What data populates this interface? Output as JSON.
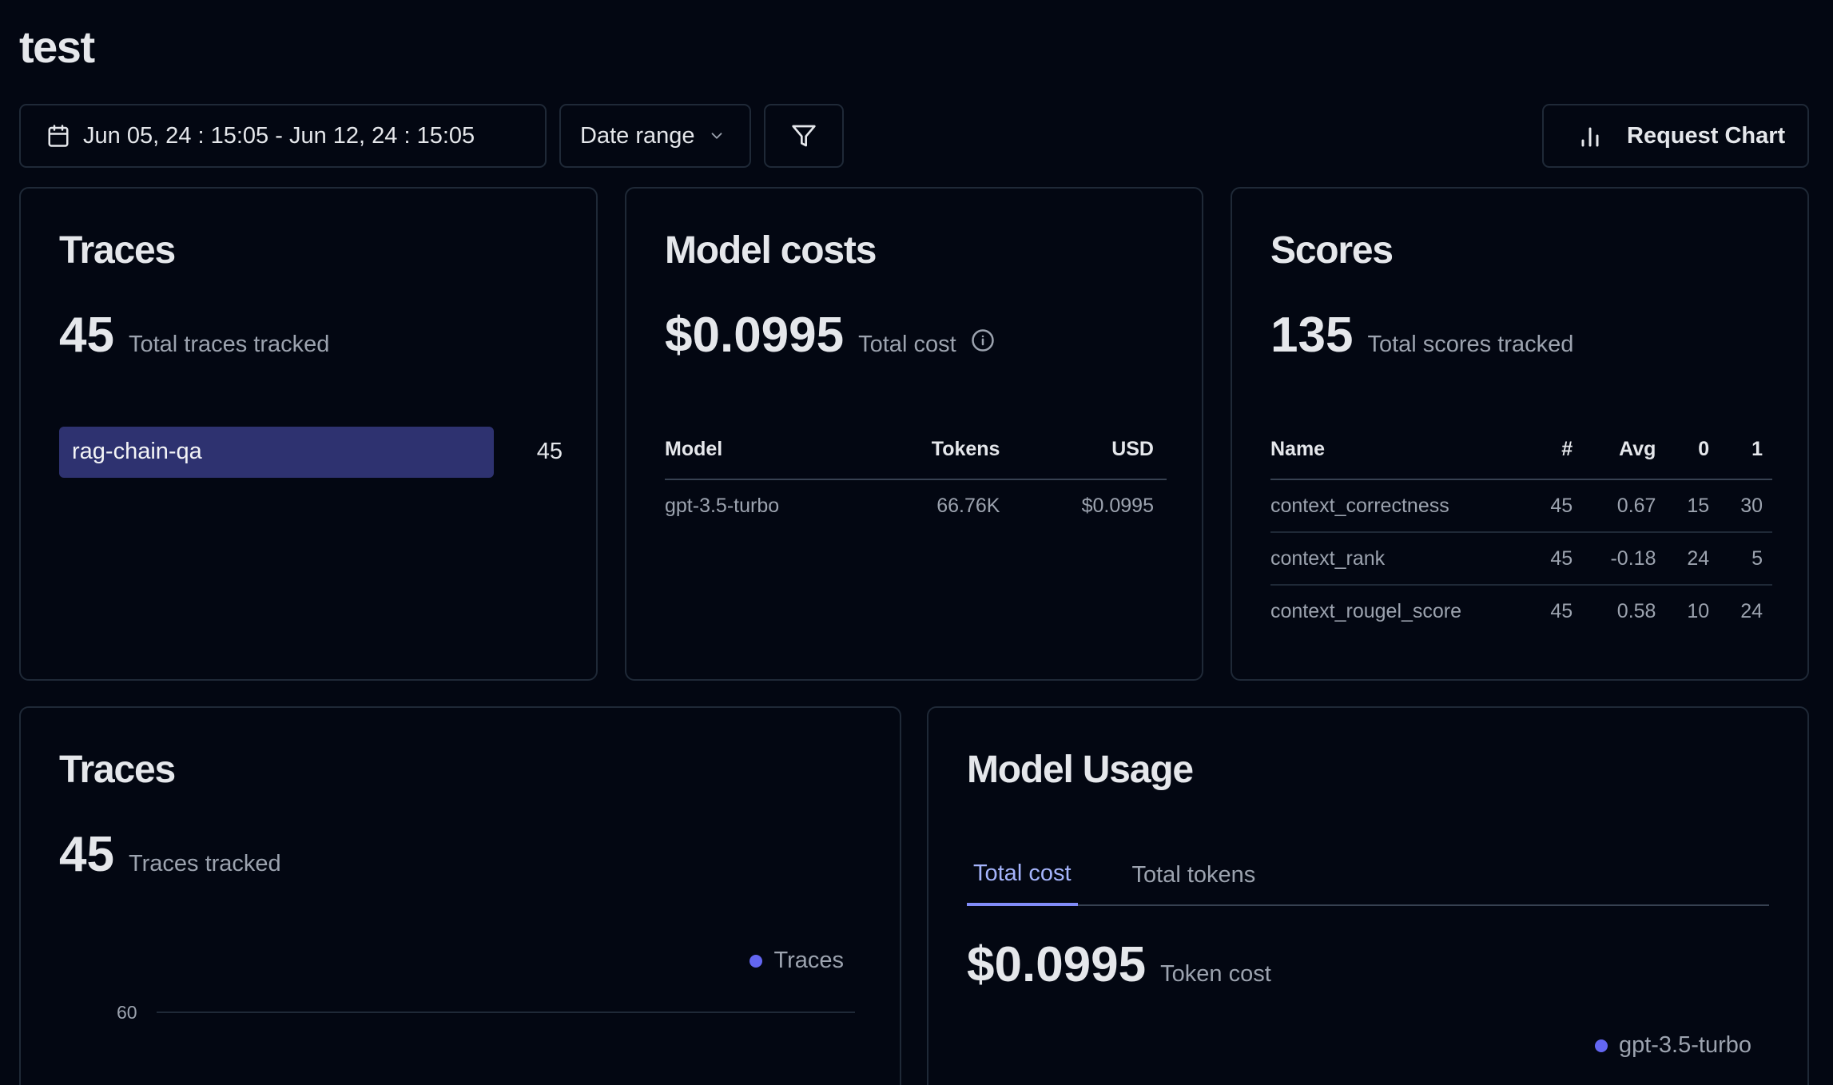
{
  "page": {
    "title": "test"
  },
  "toolbar": {
    "date_range_value": "Jun 05, 24 : 15:05 - Jun 12, 24 : 15:05",
    "date_range_select": "Date range",
    "request_chart_label": "Request Chart"
  },
  "traces_card": {
    "title": "Traces",
    "total": "45",
    "total_label": "Total traces tracked",
    "bars": [
      {
        "name": "rag-chain-qa",
        "value": "45",
        "fraction": 1.0
      }
    ]
  },
  "model_costs_card": {
    "title": "Model costs",
    "total": "$0.0995",
    "total_label": "Total cost",
    "columns": {
      "model": "Model",
      "tokens": "Tokens",
      "usd": "USD"
    },
    "rows": [
      {
        "model": "gpt-3.5-turbo",
        "tokens": "66.76K",
        "usd": "$0.0995"
      }
    ]
  },
  "scores_card": {
    "title": "Scores",
    "total": "135",
    "total_label": "Total scores tracked",
    "columns": {
      "name": "Name",
      "count": "#",
      "avg": "Avg",
      "zero": "0",
      "one": "1"
    },
    "rows": [
      {
        "name": "context_correctness",
        "count": "45",
        "avg": "0.67",
        "zero": "15",
        "one": "30"
      },
      {
        "name": "context_rank",
        "count": "45",
        "avg": "-0.18",
        "zero": "24",
        "one": "5"
      },
      {
        "name": "context_rougel_score",
        "count": "45",
        "avg": "0.58",
        "zero": "10",
        "one": "24"
      }
    ]
  },
  "traces_chart_card": {
    "title": "Traces",
    "total": "45",
    "total_label": "Traces tracked",
    "legend": "Traces",
    "y_tick": "60",
    "series_color": "#6366f1"
  },
  "model_usage_card": {
    "title": "Model Usage",
    "tabs": [
      "Total cost",
      "Total tokens"
    ],
    "active_tab": "Total cost",
    "total": "$0.0995",
    "total_label": "Token cost",
    "legend": "gpt-3.5-turbo"
  },
  "colors": {
    "background": "#030712",
    "border": "#1f2937",
    "bar": "#2e3270",
    "accent": "#818cf8"
  }
}
